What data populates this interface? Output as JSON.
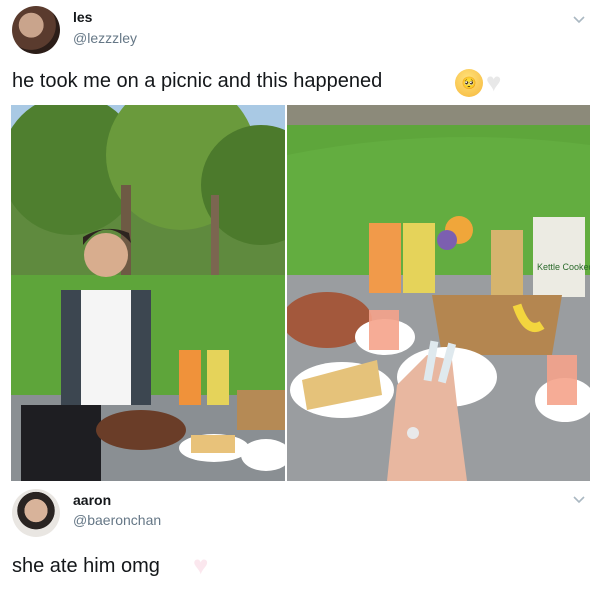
{
  "tweet": {
    "author_name": "les",
    "author_handle": "@lezzzley",
    "text": "he took me on a picnic and this happened",
    "emoji_face": "🥺",
    "emoji_heart": "♥",
    "icons": [
      "avatar",
      "chevron-down-icon",
      "pleading-face-emoji",
      "white-heart-emoji"
    ],
    "photo_left_alt": "young man in a plaid shirt sitting by a picnic spread on a grassy park",
    "photo_right_alt": "picnic blanket with sandwiches, juice, fruit and a hand with long nails",
    "photo_bag_text": "Kettle Cooked"
  },
  "reply": {
    "author_name": "aaron",
    "author_handle": "@baeronchan",
    "text": "she ate him omg",
    "emoji_heart": "♥"
  },
  "colors": {
    "name": "#14171a",
    "handle": "#657786",
    "chevron": "#aab8c2"
  }
}
